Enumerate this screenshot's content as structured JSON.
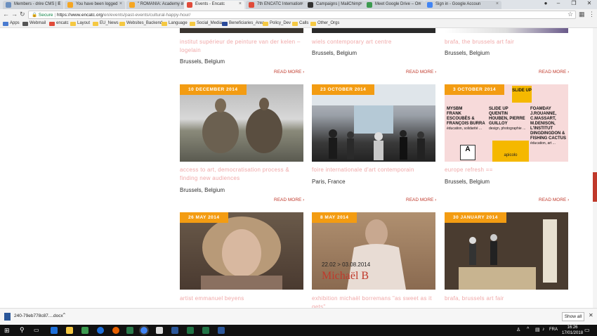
{
  "browser": {
    "tabs": [
      {
        "label": "Members - drire CMS | E",
        "color": "#6b8fbf"
      },
      {
        "label": "You have been logged",
        "color": "#f5a623"
      },
      {
        "label": "\" ROMANIA: Academy o",
        "color": "#f5a623"
      },
      {
        "label": "Events - Encatc",
        "color": "#e04b3a"
      },
      {
        "label": "7th ENCATC Internation",
        "color": "#e04b3a"
      },
      {
        "label": "Campaigns | MailChimp",
        "color": "#333"
      },
      {
        "label": "Meet Google Drive – On",
        "color": "#3c9a4f"
      },
      {
        "label": "Sign in - Google Accoun",
        "color": "#4285f4"
      }
    ],
    "url_secure": "Secure",
    "url_host": "https://www.encatc.org",
    "url_path": "/en/events/past-events/cultural-happy-hour/",
    "bookmarks": [
      "Apps",
      "Webmail",
      "encatc",
      "Layout",
      "EU_News",
      "Websites_Backend",
      "Language",
      "Social_Media",
      "Beneficiaries_Area",
      "Policy_Dev",
      "Calls",
      "Other_Orgs"
    ]
  },
  "top_row": [
    {
      "title": "institut supérieur de peinture van der kelen – logelain",
      "location": "Brussels, Belgium",
      "more": "READ MORE"
    },
    {
      "title": "wiels contemporary art centre",
      "location": "Brussels, Belgium",
      "more": "READ MORE"
    },
    {
      "title": "brafa, the brussels art fair",
      "location": "Brussels, Belgium",
      "more": "READ MORE"
    }
  ],
  "mid_row": [
    {
      "date": "10 DECEMBER 2014",
      "title": "access to art, democratisation process & finding new audiences",
      "location": "Brussels, Belgium",
      "more": "READ MORE"
    },
    {
      "date": "23 OCTOBER 2014",
      "title": "foire internationale d'art contemporain",
      "location": "Paris, France",
      "more": "READ MORE"
    },
    {
      "date": "3 OCTOBER 2014",
      "title": "europe refresh ==",
      "location": "Brussels, Belgium",
      "more": "READ MORE"
    }
  ],
  "poster": {
    "slideup_banner": "SLIDE UP",
    "col1_head": "MYSBM",
    "col1_names": "FRANK ESCOUBÈS & FRANÇOIS BURRA",
    "col1_sub": "éducation, solidarité ...",
    "col2_head": "SLIDE UP",
    "col2_names": "QUENTIN HOUBEN, PIERRE GUILLOY",
    "col2_sub": "design, photographie ...",
    "col3_head": "FOAMDAY",
    "col3_names": "J.ROUANNE, C.MASSART, M.DENISON, L'INSTITUT DINGDINGDON & FISHING CACTUS",
    "col3_sub": "éducation, art ...",
    "logo_right": "apicolo"
  },
  "bottom_row": [
    {
      "date": "26 MAY 2014",
      "title": "artist emmanuel beyens"
    },
    {
      "date": "8 MAY 2014",
      "title": "exhibition michaël borremans \"as sweet as it gets\""
    },
    {
      "date": "30 JANUARY 2014",
      "title": "brafa, brussels art fair"
    }
  ],
  "borremans_poster": {
    "dates": "22.02 > 03.08.2014",
    "name": "Michaël B"
  },
  "download": {
    "file": "240-79eb778c87....docx",
    "show_all": "Show all"
  },
  "taskbar": {
    "time": "16:26",
    "date": "17/01/2018",
    "lang": "FRA"
  }
}
